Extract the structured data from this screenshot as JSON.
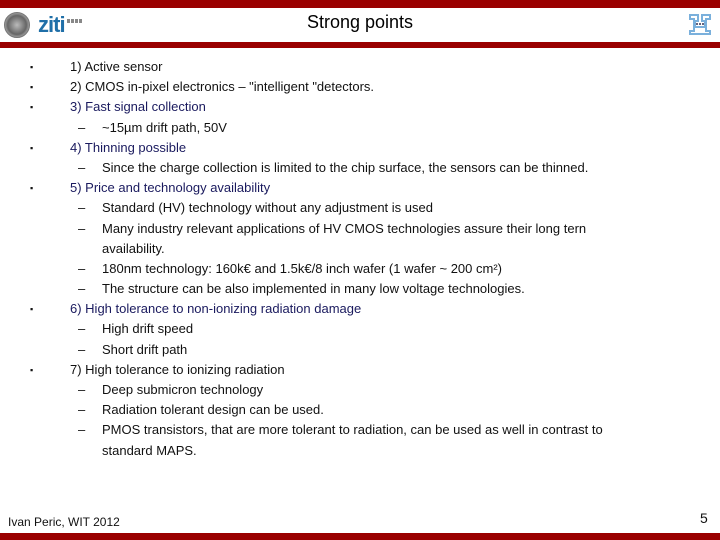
{
  "header": {
    "title": "Strong points",
    "logo_left_text": "ziti",
    "colors": {
      "accent_bar": "#9a0000",
      "logo_blue": "#1f6fa8",
      "subheading_blue": "#1a1a5e"
    }
  },
  "points": [
    {
      "label": "1) Active sensor",
      "highlight": false,
      "subs": []
    },
    {
      "label": "2) CMOS in-pixel electronics – \"intelligent \"detectors.",
      "highlight": false,
      "subs": []
    },
    {
      "label": "3) Fast signal collection",
      "highlight": true,
      "subs": [
        "~15µm drift path, 50V"
      ]
    },
    {
      "label": "4) Thinning possible",
      "highlight": true,
      "subs": [
        "Since the charge collection is limited to the chip surface, the sensors can be thinned."
      ]
    },
    {
      "label": "5) Price and technology availability",
      "highlight": true,
      "subs": [
        "Standard (HV) technology without any adjustment is used",
        "Many industry relevant applications of HV CMOS technologies assure their long tern",
        "availability.",
        "180nm technology: 160k€ and 1.5k€/8 inch wafer (1 wafer ~ 200 cm²)",
        "The structure can be also implemented in many low voltage technologies."
      ]
    },
    {
      "label": "6) High tolerance to non-ionizing radiation damage",
      "highlight": true,
      "subs": [
        "High drift speed",
        "Short drift path"
      ]
    },
    {
      "label": "7) High tolerance to ionizing radiation",
      "highlight": false,
      "subs": [
        "Deep submicron technology",
        "Radiation tolerant design can be used.",
        "PMOS transistors, that are more tolerant to radiation, can be used as well in contrast to",
        "standard MAPS."
      ]
    }
  ],
  "symbols": {
    "bullet": "▪",
    "dash": "–"
  },
  "footer": {
    "author": "Ivan Peric, WIT 2012",
    "page_number": "5"
  }
}
